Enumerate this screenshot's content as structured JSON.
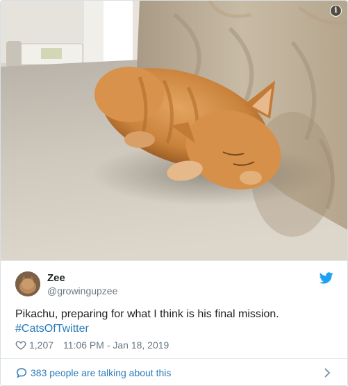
{
  "tweet": {
    "display_name": "Zee",
    "handle": "@growingupzee",
    "text": "Pikachu, preparing for what I think is his final mission.",
    "hashtag": "#CatsOfTwitter",
    "like_count": "1,207",
    "timestamp": "11:06 PM - Jan 18, 2019"
  },
  "footer": {
    "talking_label": "383 people are talking about this"
  },
  "icons": {
    "info": "info-icon",
    "bird": "twitter-bird-icon",
    "heart": "heart-icon",
    "bubble": "speech-bubble-icon",
    "chevron": "chevron-right-icon"
  },
  "colors": {
    "link": "#2b7bb9",
    "muted": "#697882",
    "text": "#1c2022",
    "twitter_blue": "#1da1f2",
    "border": "#e1e8ed"
  }
}
